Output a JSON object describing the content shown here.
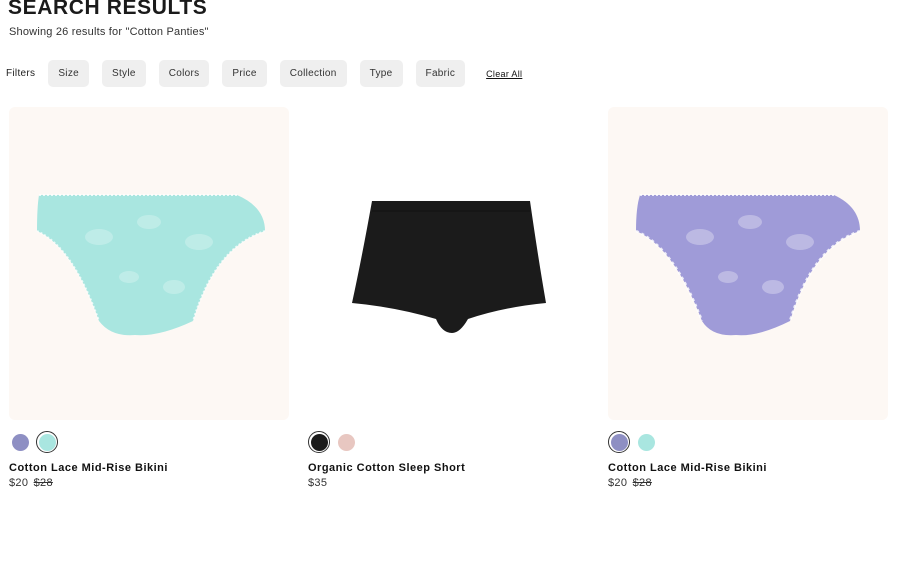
{
  "header": {
    "title": "SEARCH RESULTS",
    "result_summary": "Showing 26 results for \"Cotton Panties\""
  },
  "filters": {
    "label": "Filters",
    "chips": [
      "Size",
      "Style",
      "Colors",
      "Price",
      "Collection",
      "Type",
      "Fabric"
    ],
    "clear_all": "Clear All"
  },
  "products": [
    {
      "name": "Cotton Lace Mid-Rise Bikini",
      "price": "$20",
      "original_price": "$28",
      "image_background": "#fdf8f4",
      "garment_color": "#a9e6e0",
      "swatches": [
        {
          "color": "#8e8fc3",
          "selected": false
        },
        {
          "color": "#a9e6e0",
          "selected": true
        }
      ]
    },
    {
      "name": "Organic Cotton Sleep Short",
      "price": "$35",
      "original_price": "",
      "image_background": "#ffffff",
      "garment_color": "#1b1b1b",
      "swatches": [
        {
          "color": "#1b1b1b",
          "selected": true
        },
        {
          "color": "#e8c7c1",
          "selected": false
        }
      ]
    },
    {
      "name": "Cotton Lace Mid-Rise Bikini",
      "price": "$20",
      "original_price": "$28",
      "image_background": "#fdf8f4",
      "garment_color": "#9f9bd8",
      "swatches": [
        {
          "color": "#8e8fc3",
          "selected": true
        },
        {
          "color": "#a9e6e0",
          "selected": false
        }
      ]
    }
  ]
}
